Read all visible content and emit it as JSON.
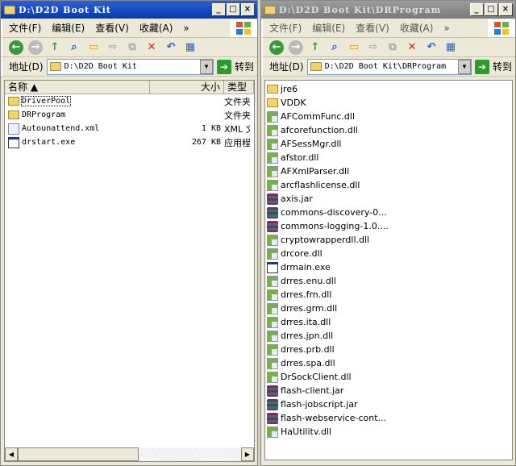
{
  "menu": [
    "文件(F)",
    "编辑(E)",
    "查看(V)",
    "收藏(A)"
  ],
  "menu_more": "»",
  "address_label": "地址(D)",
  "go_label": "转到",
  "left": {
    "title": "D:\\D2D Boot Kit",
    "address": "D:\\D2D Boot Kit",
    "columns": {
      "name": "名称 ▲",
      "size": "大小",
      "type": "类型"
    },
    "rows": [
      {
        "name": "DriverPool",
        "size": "",
        "type": "文件夹",
        "icon": "folder"
      },
      {
        "name": "DRProgram",
        "size": "",
        "type": "文件夹",
        "icon": "folder"
      },
      {
        "name": "Autounattend.xml",
        "size": "1 KB",
        "type": "XML 文档",
        "icon": "xml"
      },
      {
        "name": "drstart.exe",
        "size": "267 KB",
        "type": "应用程序",
        "icon": "exe"
      }
    ]
  },
  "right": {
    "title": "D:\\D2D Boot Kit\\DRProgram",
    "address": "D:\\D2D Boot Kit\\DRProgram",
    "items": [
      {
        "name": "jre6",
        "icon": "folder"
      },
      {
        "name": "VDDK",
        "icon": "folder"
      },
      {
        "name": "AFCommFunc.dll",
        "icon": "dll"
      },
      {
        "name": "afcorefunction.dll",
        "icon": "dll"
      },
      {
        "name": "AFSessMgr.dll",
        "icon": "dll"
      },
      {
        "name": "afstor.dll",
        "icon": "dll"
      },
      {
        "name": "AFXmlParser.dll",
        "icon": "dll"
      },
      {
        "name": "arcflashlicense.dll",
        "icon": "dll"
      },
      {
        "name": "axis.jar",
        "icon": "jar"
      },
      {
        "name": "commons-discovery-0...",
        "icon": "jar"
      },
      {
        "name": "commons-logging-1.0....",
        "icon": "jar"
      },
      {
        "name": "cryptowrapperdll.dll",
        "icon": "dll"
      },
      {
        "name": "drcore.dll",
        "icon": "dll"
      },
      {
        "name": "drmain.exe",
        "icon": "exe"
      },
      {
        "name": "drres.enu.dll",
        "icon": "dll"
      },
      {
        "name": "drres.frn.dll",
        "icon": "dll"
      },
      {
        "name": "drres.grm.dll",
        "icon": "dll"
      },
      {
        "name": "drres.ita.dll",
        "icon": "dll"
      },
      {
        "name": "drres.jpn.dll",
        "icon": "dll"
      },
      {
        "name": "drres.prb.dll",
        "icon": "dll"
      },
      {
        "name": "drres.spa.dll",
        "icon": "dll"
      },
      {
        "name": "DrSockClient.dll",
        "icon": "dll"
      },
      {
        "name": "flash-client.jar",
        "icon": "jar"
      },
      {
        "name": "flash-jobscript.jar",
        "icon": "jar"
      },
      {
        "name": "flash-webservice-cont...",
        "icon": "jar"
      },
      {
        "name": "HaUtilitv.dll",
        "icon": "dll"
      }
    ]
  }
}
